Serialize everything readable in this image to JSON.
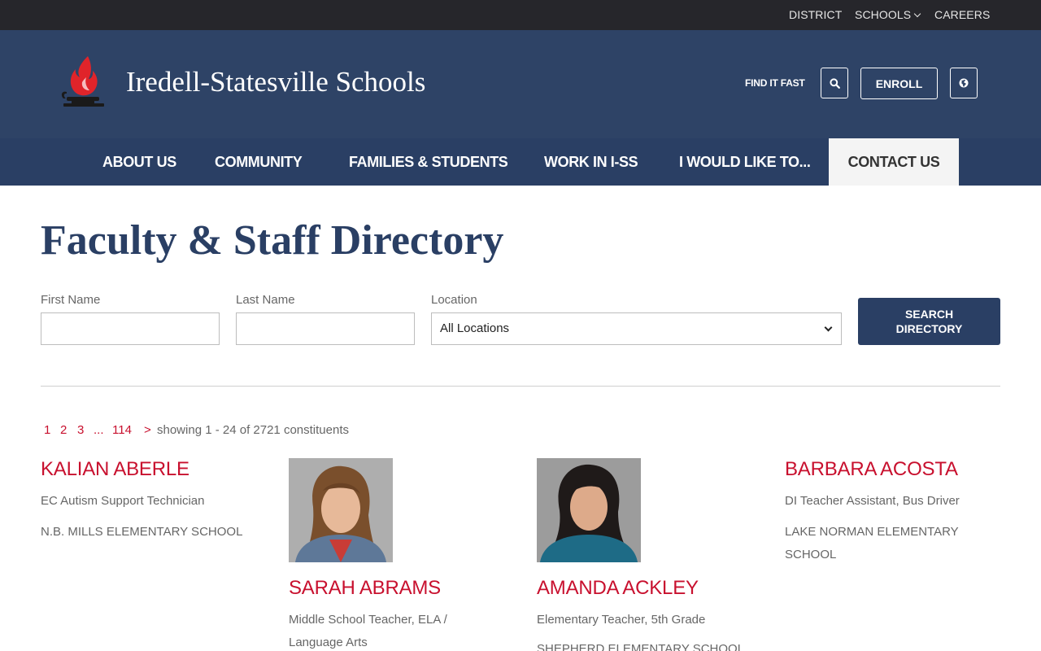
{
  "utility_nav": {
    "district": "DISTRICT",
    "schools": "SCHOOLS",
    "careers": "CAREERS"
  },
  "header": {
    "site_title": "Iredell-Statesville Schools",
    "find_it_fast": "FIND IT FAST",
    "enroll": "ENROLL"
  },
  "main_nav": [
    {
      "label": "ABOUT US"
    },
    {
      "label": "COMMUNITY"
    },
    {
      "label": "FAMILIES & STUDENTS"
    },
    {
      "label": "WORK IN I-SS"
    },
    {
      "label": "I WOULD LIKE TO..."
    },
    {
      "label": "CONTACT US",
      "active": true
    }
  ],
  "page": {
    "title": "Faculty & Staff Directory"
  },
  "search_form": {
    "first_name_label": "First Name",
    "first_name_value": "",
    "last_name_label": "Last Name",
    "last_name_value": "",
    "location_label": "Location",
    "location_value": "All Locations",
    "button_line1": "SEARCH",
    "button_line2": "DIRECTORY"
  },
  "pagination": {
    "pages": [
      "1",
      "2",
      "3",
      "...",
      "114"
    ],
    "next": ">",
    "info": "showing 1 - 24 of 2721 constituents"
  },
  "people": [
    {
      "name": "KALIAN ABERLE",
      "title": "EC Autism Support Technician",
      "school": "N.B. MILLS ELEMENTARY SCHOOL",
      "has_photo": false
    },
    {
      "name": "SARAH ABRAMS",
      "title_line1": "Middle School Teacher, ELA /",
      "title_line2": "Language Arts",
      "has_photo": true
    },
    {
      "name": "AMANDA ACKLEY",
      "title": "Elementary Teacher, 5th Grade",
      "school": "SHEPHERD ELEMENTARY SCHOOL",
      "has_photo": true
    },
    {
      "name": "BARBARA ACOSTA",
      "title": "DI Teacher Assistant, Bus Driver",
      "school_line1": "LAKE NORMAN ELEMENTARY",
      "school_line2": "SCHOOL",
      "has_photo": false
    }
  ],
  "colors": {
    "header": "#2e4366",
    "nav": "#2a3f64",
    "utility": "#26262b",
    "accent_red": "#c8102e"
  },
  "icons": [
    "flame-lamp-logo-icon",
    "search-icon",
    "globe-icon",
    "chevron-down-icon"
  ]
}
